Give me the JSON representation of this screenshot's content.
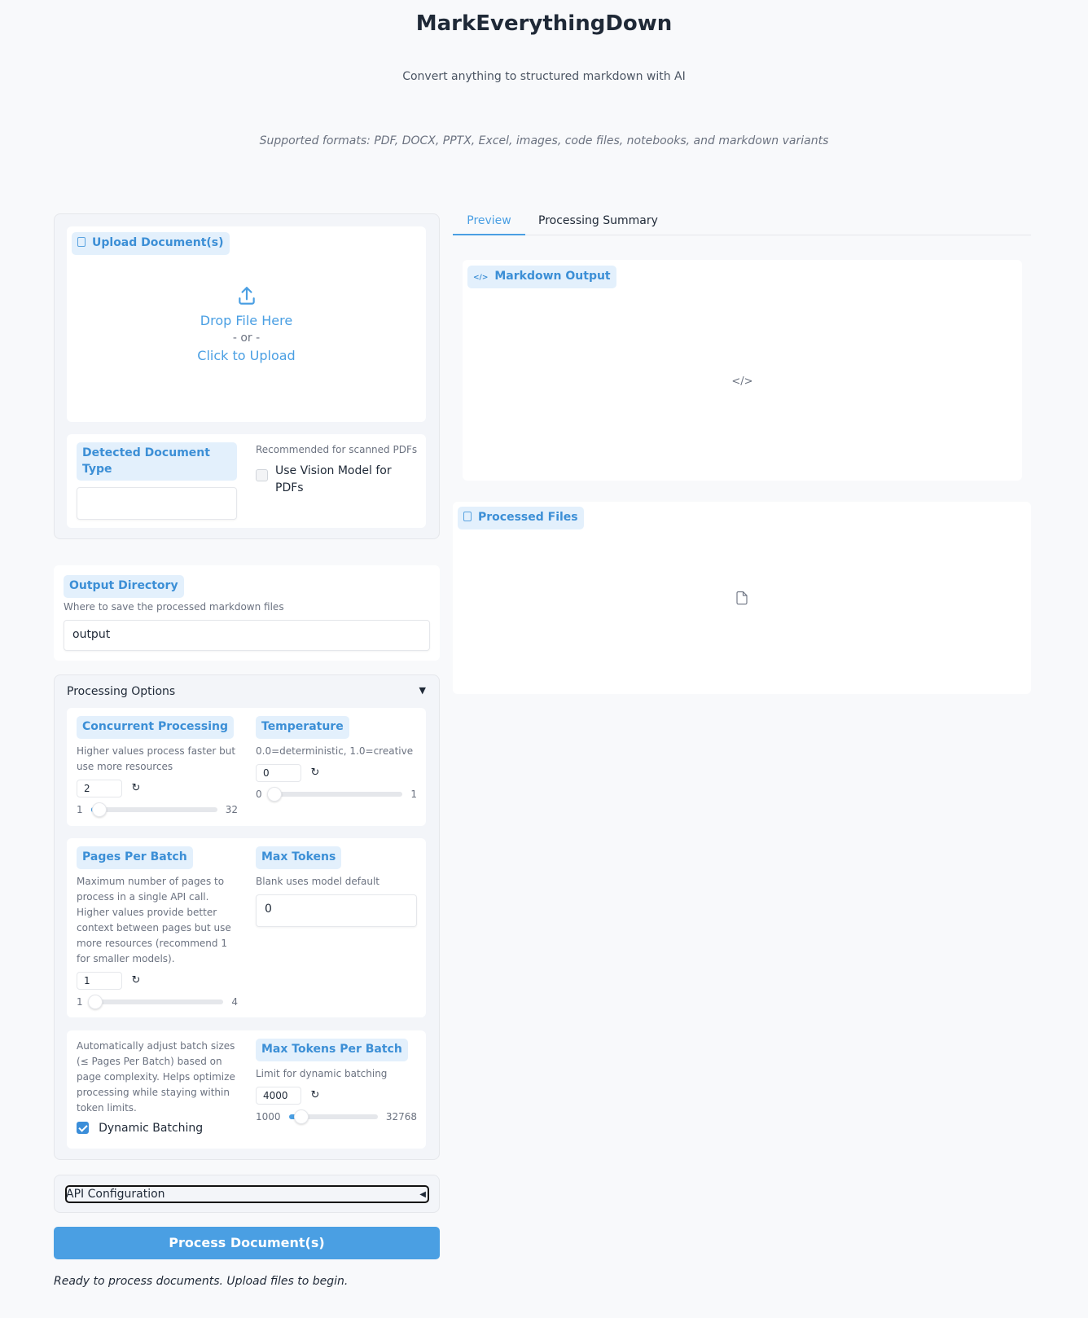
{
  "header": {
    "title": "MarkEverythingDown",
    "subtitle": "Convert anything to structured markdown with AI",
    "formats": "Supported formats: PDF, DOCX, PPTX, Excel, images, code files, notebooks, and markdown variants"
  },
  "upload": {
    "label": "Upload Document(s)",
    "drop": "Drop File Here",
    "or": "- or -",
    "click": "Click to Upload"
  },
  "doc_type": {
    "label": "Detected Document Type",
    "value": ""
  },
  "vision": {
    "info": "Recommended for scanned PDFs",
    "label": "Use Vision Model for PDFs",
    "checked": false
  },
  "output_dir": {
    "label": "Output Directory",
    "info": "Where to save the processed markdown files",
    "value": "output"
  },
  "processing": {
    "title": "Processing Options",
    "concurrent": {
      "label": "Concurrent Processing",
      "info": "Higher values process faster but use more resources",
      "value": "2",
      "min": "1",
      "max": "32",
      "fraction": 0.032
    },
    "temperature": {
      "label": "Temperature",
      "info": "0.0=deterministic, 1.0=creative",
      "value": "0",
      "min": "0",
      "max": "1",
      "fraction": 0.0
    },
    "pages_per_batch": {
      "label": "Pages Per Batch",
      "info": "Maximum number of pages to process in a single API call. Higher values provide better context between pages but use more resources (recommend 1 for smaller models).",
      "value": "1",
      "min": "1",
      "max": "4",
      "fraction": 0.0
    },
    "max_tokens": {
      "label": "Max Tokens",
      "info": "Blank uses model default",
      "value": "0"
    },
    "dynamic": {
      "info": "Automatically adjust batch sizes (≤ Pages Per Batch) based on page complexity. Helps optimize processing while staying within token limits.",
      "label": "Dynamic Batching",
      "checked": true
    },
    "max_tokens_batch": {
      "label": "Max Tokens Per Batch",
      "info": "Limit for dynamic batching",
      "value": "4000",
      "min": "1000",
      "max": "32768",
      "fraction": 0.094
    }
  },
  "api": {
    "title": "API Configuration"
  },
  "process_button": "Process Document(s)",
  "status": "Ready to process documents. Upload files to begin.",
  "tabs": [
    {
      "label": "Preview",
      "active": true
    },
    {
      "label": "Processing Summary",
      "active": false
    }
  ],
  "markdown_output": {
    "label": "Markdown Output"
  },
  "processed_files": {
    "label": "Processed Files"
  },
  "colors": {
    "accent": "#4a9fe3",
    "label_bg": "#e3f0fc",
    "label_text": "#3c8fd6"
  },
  "icons": {
    "upload": "upload-icon",
    "file": "file-icon",
    "code": "code-icon",
    "reset": "reset-icon",
    "chevron": "chevron-down-icon"
  }
}
